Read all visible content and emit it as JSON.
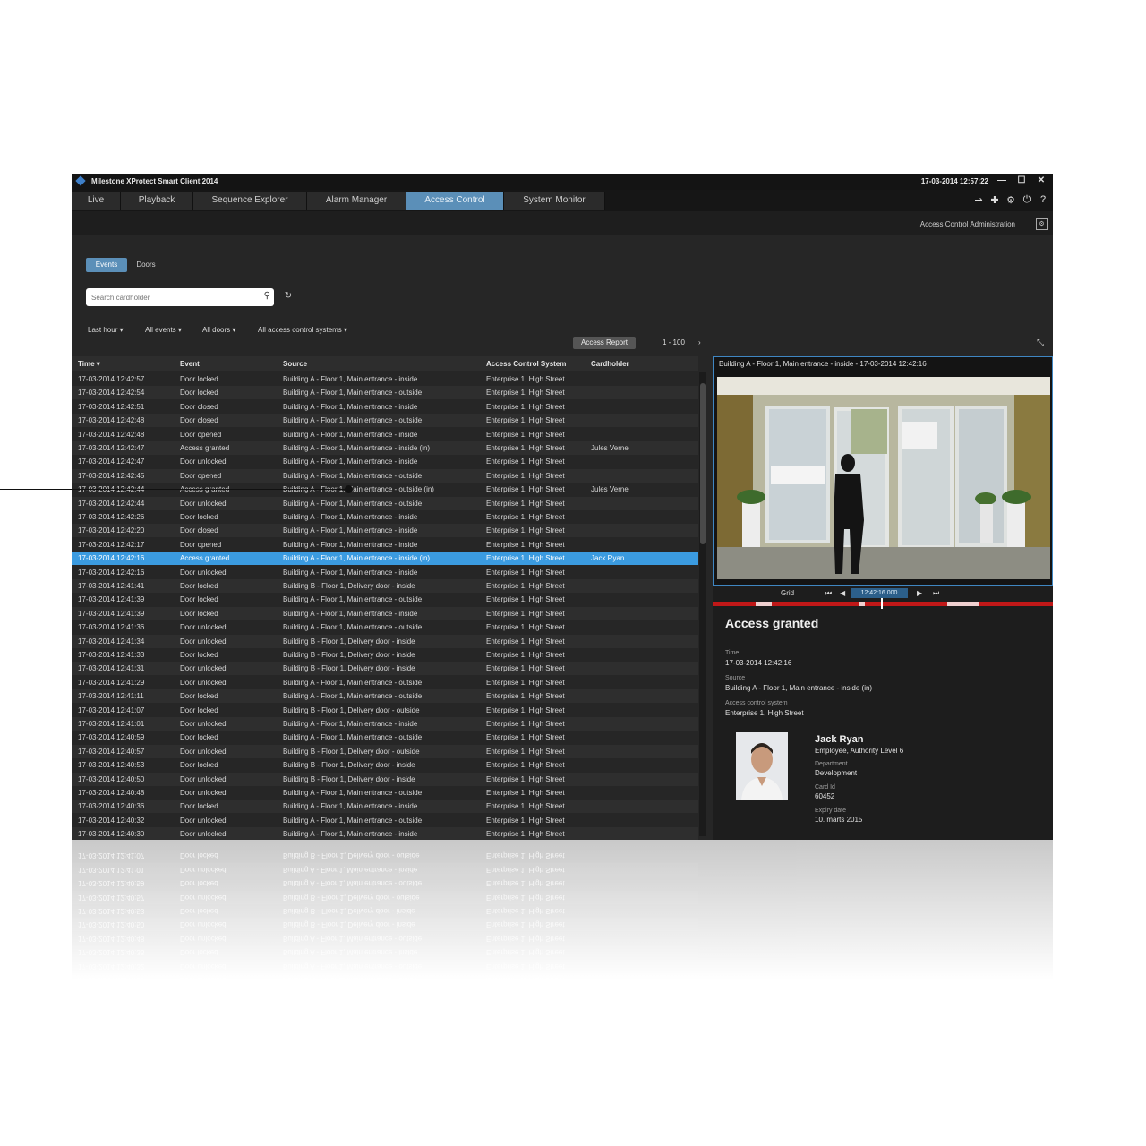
{
  "window": {
    "title": "Milestone XProtect Smart Client 2014",
    "clock": "17-03-2014 12:57:22",
    "controls": [
      "—",
      "☐",
      "✕"
    ]
  },
  "tabs": [
    {
      "label": "Live"
    },
    {
      "label": "Playback"
    },
    {
      "label": "Sequence Explorer"
    },
    {
      "label": "Alarm Manager"
    },
    {
      "label": "Access Control",
      "active": true
    },
    {
      "label": "System Monitor"
    }
  ],
  "toolbar_icons": [
    "pin-icon",
    "pin-icon",
    "gear-icon",
    "power-icon",
    "help-icon"
  ],
  "subbar": {
    "admin_link": "Access Control Administration"
  },
  "view_toggle": {
    "events": "Events",
    "doors": "Doors"
  },
  "search": {
    "placeholder": "Search cardholder"
  },
  "filters": [
    "Last hour",
    "All events",
    "All doors",
    "All access control systems"
  ],
  "report_button": "Access Report",
  "paging": {
    "range": "1 - 100",
    "next": "›"
  },
  "table": {
    "headers": [
      "Time",
      "Event",
      "Source",
      "Access Control System",
      "Cardholder"
    ],
    "rows": [
      [
        "17-03-2014 12:42:57",
        "Door locked",
        "Building A - Floor 1, Main entrance - inside",
        "Enterprise 1, High Street",
        ""
      ],
      [
        "17-03-2014 12:42:54",
        "Door locked",
        "Building A - Floor 1, Main entrance - outside",
        "Enterprise 1, High Street",
        ""
      ],
      [
        "17-03-2014 12:42:51",
        "Door closed",
        "Building A - Floor 1, Main entrance - inside",
        "Enterprise 1, High Street",
        ""
      ],
      [
        "17-03-2014 12:42:48",
        "Door closed",
        "Building A - Floor 1, Main entrance - outside",
        "Enterprise 1, High Street",
        ""
      ],
      [
        "17-03-2014 12:42:48",
        "Door opened",
        "Building A - Floor 1, Main entrance - inside",
        "Enterprise 1, High Street",
        ""
      ],
      [
        "17-03-2014 12:42:47",
        "Access granted",
        "Building A - Floor 1, Main entrance - inside (in)",
        "Enterprise 1, High Street",
        "Jules Verne"
      ],
      [
        "17-03-2014 12:42:47",
        "Door unlocked",
        "Building A - Floor 1, Main entrance - inside",
        "Enterprise 1, High Street",
        ""
      ],
      [
        "17-03-2014 12:42:45",
        "Door opened",
        "Building A - Floor 1, Main entrance - outside",
        "Enterprise 1, High Street",
        ""
      ],
      [
        "17-03-2014 12:42:44",
        "Access granted",
        "Building A - Floor 1, Main entrance - outside (in)",
        "Enterprise 1, High Street",
        "Jules Verne"
      ],
      [
        "17-03-2014 12:42:44",
        "Door unlocked",
        "Building A - Floor 1, Main entrance - outside",
        "Enterprise 1, High Street",
        ""
      ],
      [
        "17-03-2014 12:42:26",
        "Door locked",
        "Building A - Floor 1, Main entrance - inside",
        "Enterprise 1, High Street",
        ""
      ],
      [
        "17-03-2014 12:42:20",
        "Door closed",
        "Building A - Floor 1, Main entrance - inside",
        "Enterprise 1, High Street",
        ""
      ],
      [
        "17-03-2014 12:42:17",
        "Door opened",
        "Building A - Floor 1, Main entrance - inside",
        "Enterprise 1, High Street",
        ""
      ],
      [
        "17-03-2014 12:42:16",
        "Access granted",
        "Building A - Floor 1, Main entrance - inside (in)",
        "Enterprise 1, High Street",
        "Jack Ryan"
      ],
      [
        "17-03-2014 12:42:16",
        "Door unlocked",
        "Building A - Floor 1, Main entrance - inside",
        "Enterprise 1, High Street",
        ""
      ],
      [
        "17-03-2014 12:41:41",
        "Door locked",
        "Building B - Floor 1, Delivery door - inside",
        "Enterprise 1, High Street",
        ""
      ],
      [
        "17-03-2014 12:41:39",
        "Door locked",
        "Building A - Floor 1, Main entrance - outside",
        "Enterprise 1, High Street",
        ""
      ],
      [
        "17-03-2014 12:41:39",
        "Door locked",
        "Building A - Floor 1, Main entrance - inside",
        "Enterprise 1, High Street",
        ""
      ],
      [
        "17-03-2014 12:41:36",
        "Door unlocked",
        "Building A - Floor 1, Main entrance - outside",
        "Enterprise 1, High Street",
        ""
      ],
      [
        "17-03-2014 12:41:34",
        "Door unlocked",
        "Building B - Floor 1, Delivery door - inside",
        "Enterprise 1, High Street",
        ""
      ],
      [
        "17-03-2014 12:41:33",
        "Door locked",
        "Building B - Floor 1, Delivery door - inside",
        "Enterprise 1, High Street",
        ""
      ],
      [
        "17-03-2014 12:41:31",
        "Door unlocked",
        "Building B - Floor 1, Delivery door - inside",
        "Enterprise 1, High Street",
        ""
      ],
      [
        "17-03-2014 12:41:29",
        "Door unlocked",
        "Building A - Floor 1, Main entrance - outside",
        "Enterprise 1, High Street",
        ""
      ],
      [
        "17-03-2014 12:41:11",
        "Door locked",
        "Building A - Floor 1, Main entrance - outside",
        "Enterprise 1, High Street",
        ""
      ],
      [
        "17-03-2014 12:41:07",
        "Door locked",
        "Building B - Floor 1, Delivery door - outside",
        "Enterprise 1, High Street",
        ""
      ],
      [
        "17-03-2014 12:41:01",
        "Door unlocked",
        "Building A - Floor 1, Main entrance - inside",
        "Enterprise 1, High Street",
        ""
      ],
      [
        "17-03-2014 12:40:59",
        "Door locked",
        "Building A - Floor 1, Main entrance - outside",
        "Enterprise 1, High Street",
        ""
      ],
      [
        "17-03-2014 12:40:57",
        "Door unlocked",
        "Building B - Floor 1, Delivery door - outside",
        "Enterprise 1, High Street",
        ""
      ],
      [
        "17-03-2014 12:40:53",
        "Door locked",
        "Building B - Floor 1, Delivery door - inside",
        "Enterprise 1, High Street",
        ""
      ],
      [
        "17-03-2014 12:40:50",
        "Door unlocked",
        "Building B - Floor 1, Delivery door - inside",
        "Enterprise 1, High Street",
        ""
      ],
      [
        "17-03-2014 12:40:48",
        "Door unlocked",
        "Building A - Floor 1, Main entrance - outside",
        "Enterprise 1, High Street",
        ""
      ],
      [
        "17-03-2014 12:40:36",
        "Door locked",
        "Building A - Floor 1, Main entrance - inside",
        "Enterprise 1, High Street",
        ""
      ],
      [
        "17-03-2014 12:40:32",
        "Door unlocked",
        "Building A - Floor 1, Main entrance - outside",
        "Enterprise 1, High Street",
        ""
      ],
      [
        "17-03-2014 12:40:30",
        "Door unlocked",
        "Building A - Floor 1, Main entrance - inside",
        "Enterprise 1, High Street",
        ""
      ]
    ],
    "selected_row": 13
  },
  "camera": {
    "title": "Building A - Floor 1, Main entrance - inside - 17-03-2014 12:42:16",
    "playback": {
      "mode": "Grid",
      "time": "12:42:16.000"
    }
  },
  "details": {
    "heading": "Access granted",
    "time_label": "Time",
    "time_value": "17-03-2014 12:42:16",
    "source_label": "Source",
    "source_value": "Building A - Floor 1, Main entrance - inside (in)",
    "acs_label": "Access control system",
    "acs_value": "Enterprise 1, High Street",
    "cardholder": {
      "name": "Jack Ryan",
      "role": "Employee, Authority Level 6",
      "department_label": "Department",
      "department_value": "Development",
      "card_label": "Card Id",
      "card_value": "60452",
      "expiry_label": "Expiry date",
      "expiry_value": "10. marts 2015"
    }
  },
  "colors": {
    "app_bg": "#262626",
    "accent": "#5b8fb8",
    "selected_row": "#3b9be0",
    "timeline": "#c01818"
  }
}
